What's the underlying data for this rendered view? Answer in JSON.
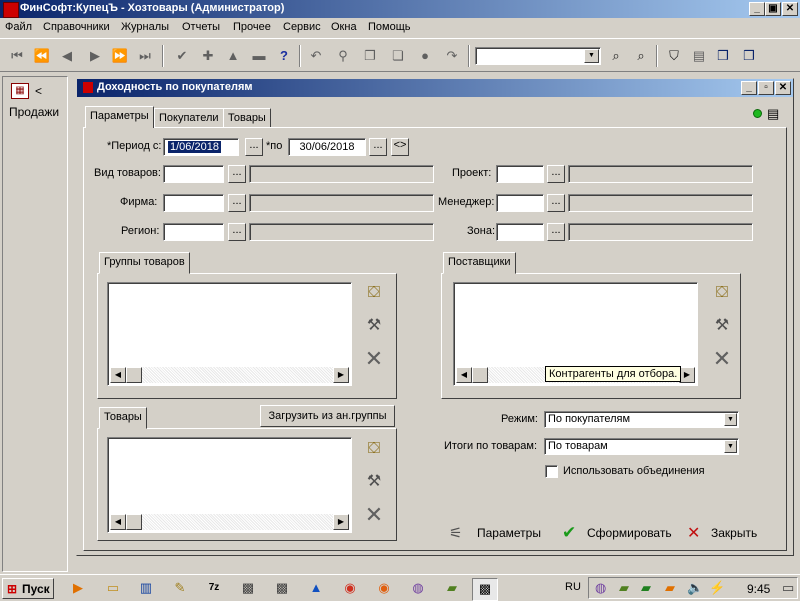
{
  "app": {
    "title": "ФинСофт:КупецЪ - Хозтовары  (Администратор)",
    "caption_buttons": [
      "_",
      "▣",
      "✕"
    ]
  },
  "menu": [
    "Файл",
    "Справочники",
    "Журналы",
    "Отчеты",
    "Прочее",
    "Сервис",
    "Окна",
    "Помощь"
  ],
  "left_panel": {
    "arrow": "<",
    "label": "Продажи"
  },
  "window": {
    "title": "Доходность по покупателям",
    "tabs": [
      "Параметры",
      "Покупатели",
      "Товары"
    ],
    "period": {
      "label_from": "*Период с:",
      "from_value": "1/06/2018",
      "label_to": "*по",
      "to_value": "30/06/2018",
      "dots": "...",
      "swap": "<>"
    },
    "filters_left": [
      {
        "label": "Вид товаров:",
        "value": ""
      },
      {
        "label": "Фирма:",
        "value": ""
      },
      {
        "label": "Регион:",
        "value": ""
      }
    ],
    "filters_right": [
      {
        "label": "Проект:",
        "value": ""
      },
      {
        "label": "Менеджер:",
        "value": ""
      },
      {
        "label": "Зона:",
        "value": ""
      }
    ],
    "groups_panel": {
      "tab": "Группы товаров"
    },
    "suppliers_panel": {
      "tab": "Поставщики"
    },
    "goods_panel": {
      "tab": "Товары",
      "load_button": "Загрузить из ан.группы"
    },
    "tooltip": "Контрагенты для отбора.",
    "mode": {
      "label": "Режим:",
      "value": "По покупателям"
    },
    "totals": {
      "label": "Итоги по товарам:",
      "value": "По товарам"
    },
    "use_unions": {
      "label": "Использовать объединения",
      "checked": false
    },
    "actions": {
      "params": "Параметры",
      "generate": "Сформировать",
      "close": "Закрыть"
    }
  },
  "taskbar": {
    "start": "Пуск",
    "lang": "RU",
    "clock": "9:45"
  }
}
